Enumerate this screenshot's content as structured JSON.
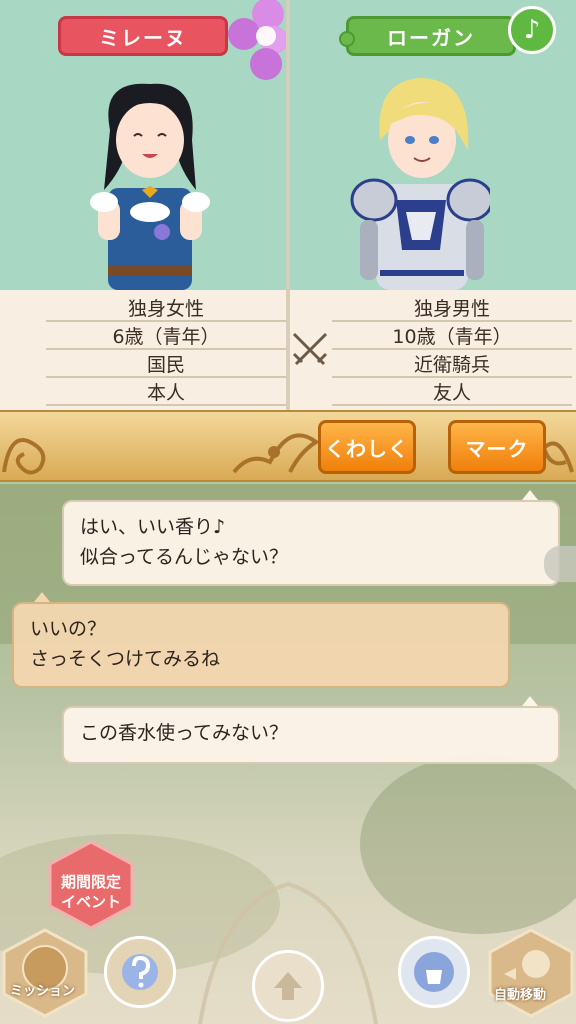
{
  "characters": {
    "left": {
      "name": "ミレーヌ",
      "info": [
        "独身女性",
        "6歳（青年）",
        "国民",
        "本人"
      ]
    },
    "right": {
      "name": "ローガン",
      "info": [
        "独身男性",
        "10歳（青年）",
        "近衛騎兵",
        "友人"
      ]
    }
  },
  "buttons": {
    "detail": "くわしく",
    "mark": "マーク"
  },
  "chat": [
    {
      "line1": "はい、いい香り♪",
      "line2": "似合ってるんじゃない？"
    },
    {
      "line1": "いいの？",
      "line2": "さっそくつけてみるね"
    },
    {
      "line1": "この香水使ってみない？"
    }
  ],
  "menu": {
    "event_line1": "期間限定",
    "event_line2": "イベント",
    "mission": "ミッション",
    "auto_move": "自動移動"
  },
  "colors": {
    "left_tag": "#e85561",
    "right_tag": "#6ab94a",
    "accent_orange": "#f07f0a",
    "top_bg": "#a8d7c4"
  }
}
